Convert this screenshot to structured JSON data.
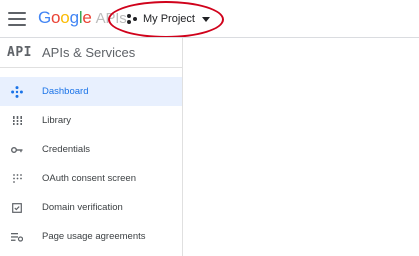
{
  "app": {
    "logo_letters": [
      "G",
      "o",
      "o",
      "g",
      "l",
      "e"
    ],
    "logo_suffix": "APIs",
    "menu_icon": "hamburger-menu-icon"
  },
  "project": {
    "label": "My Project",
    "icon": "project-dots-icon",
    "dropdown_icon": "caret-down-icon"
  },
  "annotation": {
    "shape": "ellipse",
    "color": "#d0021b",
    "target": "project-picker"
  },
  "sidebar": {
    "badge": "API",
    "title": "APIs & Services",
    "items": [
      {
        "label": "Dashboard",
        "icon": "dashboard-diamond-icon",
        "active": true
      },
      {
        "label": "Library",
        "icon": "library-icon",
        "active": false
      },
      {
        "label": "Credentials",
        "icon": "key-icon",
        "active": false
      },
      {
        "label": "OAuth consent screen",
        "icon": "oauth-dots-icon",
        "active": false
      },
      {
        "label": "Domain verification",
        "icon": "checkbox-icon",
        "active": false
      },
      {
        "label": "Page usage agreements",
        "icon": "settings-list-icon",
        "active": false
      }
    ]
  },
  "colors": {
    "active_bg": "#e8f0fe",
    "active_text": "#1a73e8",
    "google_blue": "#4285f4",
    "google_red": "#ea4335",
    "google_yellow": "#fbbc05",
    "google_green": "#34a853"
  }
}
